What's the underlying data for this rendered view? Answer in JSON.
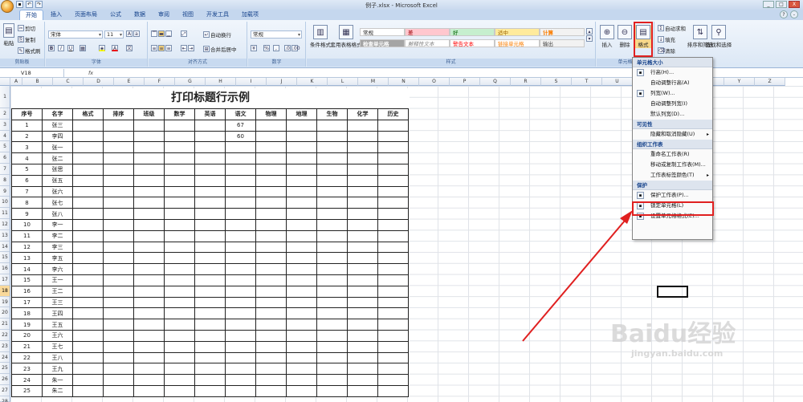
{
  "window": {
    "title": "例子.xlsx - Microsoft Excel",
    "min": "_",
    "max": "□",
    "close": "X"
  },
  "tabs": [
    "开始",
    "插入",
    "页面布局",
    "公式",
    "数据",
    "审阅",
    "视图",
    "开发工具",
    "加载项"
  ],
  "ribbon": {
    "clipboard": {
      "label": "剪贴板",
      "paste": "粘贴",
      "cut": "剪切",
      "copy": "复制",
      "format_painter": "格式刷"
    },
    "font": {
      "label": "字体",
      "name": "宋体",
      "size": "11",
      "bold": "B",
      "italic": "I",
      "underline": "U"
    },
    "align": {
      "label": "对齐方式",
      "wrap": "自动换行",
      "merge": "合并后居中"
    },
    "number": {
      "label": "数字",
      "format": "常规",
      "percent": "%",
      "comma": ","
    },
    "styles": {
      "label": "样式",
      "cond": "条件格式",
      "table": "套用表格格式",
      "cells": [
        "常规",
        "差",
        "好",
        "适中",
        "计算",
        "检查单元格",
        "解释性文本",
        "警告文本",
        "链接单元格",
        "输出"
      ]
    },
    "cells": {
      "label": "单元格",
      "insert": "插入",
      "delete": "删除",
      "format": "格式"
    },
    "editing": {
      "autosum": "自动求和",
      "fill": "填充",
      "clear": "清除",
      "sort": "排序和筛选",
      "find": "查找和选择"
    }
  },
  "formula_bar": {
    "cell_ref": "V18",
    "fx": "fx"
  },
  "columns": [
    "A",
    "B",
    "C",
    "D",
    "E",
    "F",
    "G",
    "H",
    "I",
    "J",
    "K",
    "L",
    "M",
    "N",
    "O",
    "P",
    "Q",
    "R",
    "S",
    "T",
    "U",
    "V",
    "W",
    "X",
    "Y",
    "Z"
  ],
  "sheet": {
    "title": "打印标题行示例",
    "headers": [
      "序号",
      "名字",
      "格式",
      "排序",
      "班级",
      "数学",
      "英语",
      "语文",
      "物理",
      "地理",
      "生物",
      "化学",
      "历史"
    ],
    "rows": [
      [
        "1",
        "张三",
        "",
        "",
        "",
        "",
        "",
        "67",
        "",
        "",
        "",
        "",
        ""
      ],
      [
        "2",
        "李四",
        "",
        "",
        "",
        "",
        "",
        "60",
        "",
        "",
        "",
        "",
        ""
      ],
      [
        "3",
        "张一",
        "",
        "",
        "",
        "",
        "",
        "",
        "",
        "",
        "",
        "",
        ""
      ],
      [
        "4",
        "张二",
        "",
        "",
        "",
        "",
        "",
        "",
        "",
        "",
        "",
        "",
        ""
      ],
      [
        "5",
        "张思",
        "",
        "",
        "",
        "",
        "",
        "",
        "",
        "",
        "",
        "",
        ""
      ],
      [
        "6",
        "张五",
        "",
        "",
        "",
        "",
        "",
        "",
        "",
        "",
        "",
        "",
        ""
      ],
      [
        "7",
        "张六",
        "",
        "",
        "",
        "",
        "",
        "",
        "",
        "",
        "",
        "",
        ""
      ],
      [
        "8",
        "张七",
        "",
        "",
        "",
        "",
        "",
        "",
        "",
        "",
        "",
        "",
        ""
      ],
      [
        "9",
        "张八",
        "",
        "",
        "",
        "",
        "",
        "",
        "",
        "",
        "",
        "",
        ""
      ],
      [
        "10",
        "李一",
        "",
        "",
        "",
        "",
        "",
        "",
        "",
        "",
        "",
        "",
        ""
      ],
      [
        "11",
        "李二",
        "",
        "",
        "",
        "",
        "",
        "",
        "",
        "",
        "",
        "",
        ""
      ],
      [
        "12",
        "李三",
        "",
        "",
        "",
        "",
        "",
        "",
        "",
        "",
        "",
        "",
        ""
      ],
      [
        "13",
        "李五",
        "",
        "",
        "",
        "",
        "",
        "",
        "",
        "",
        "",
        "",
        ""
      ],
      [
        "14",
        "李六",
        "",
        "",
        "",
        "",
        "",
        "",
        "",
        "",
        "",
        "",
        ""
      ],
      [
        "15",
        "王一",
        "",
        "",
        "",
        "",
        "",
        "",
        "",
        "",
        "",
        "",
        ""
      ],
      [
        "16",
        "王二",
        "",
        "",
        "",
        "",
        "",
        "",
        "",
        "",
        "",
        "",
        ""
      ],
      [
        "17",
        "王三",
        "",
        "",
        "",
        "",
        "",
        "",
        "",
        "",
        "",
        "",
        ""
      ],
      [
        "18",
        "王四",
        "",
        "",
        "",
        "",
        "",
        "",
        "",
        "",
        "",
        "",
        ""
      ],
      [
        "19",
        "王五",
        "",
        "",
        "",
        "",
        "",
        "",
        "",
        "",
        "",
        "",
        ""
      ],
      [
        "20",
        "王六",
        "",
        "",
        "",
        "",
        "",
        "",
        "",
        "",
        "",
        "",
        ""
      ],
      [
        "21",
        "王七",
        "",
        "",
        "",
        "",
        "",
        "",
        "",
        "",
        "",
        "",
        ""
      ],
      [
        "22",
        "王八",
        "",
        "",
        "",
        "",
        "",
        "",
        "",
        "",
        "",
        "",
        ""
      ],
      [
        "23",
        "王九",
        "",
        "",
        "",
        "",
        "",
        "",
        "",
        "",
        "",
        "",
        ""
      ],
      [
        "24",
        "朱一",
        "",
        "",
        "",
        "",
        "",
        "",
        "",
        "",
        "",
        "",
        ""
      ],
      [
        "25",
        "朱二",
        "",
        "",
        "",
        "",
        "",
        "",
        "",
        "",
        "",
        "",
        ""
      ]
    ]
  },
  "menu": {
    "sections": [
      {
        "title": "单元格大小",
        "items": [
          {
            "label": "行高(H)...",
            "icon": "row-height-icon"
          },
          {
            "label": "自动调整行高(A)",
            "icon": ""
          },
          {
            "label": "列宽(W)...",
            "icon": "column-width-icon"
          },
          {
            "label": "自动调整列宽(I)",
            "icon": ""
          },
          {
            "label": "默认列宽(D)...",
            "icon": ""
          }
        ]
      },
      {
        "title": "可见性",
        "items": [
          {
            "label": "隐藏和取消隐藏(U)",
            "icon": "",
            "arrow": "▸"
          }
        ]
      },
      {
        "title": "组织工作表",
        "items": [
          {
            "label": "重命名工作表(R)",
            "icon": ""
          },
          {
            "label": "移动或复制工作表(M)...",
            "icon": ""
          },
          {
            "label": "工作表标签颜色(T)",
            "icon": "",
            "arrow": "▸"
          }
        ]
      },
      {
        "title": "保护",
        "items": [
          {
            "label": "保护工作表(P)...",
            "icon": "protect-sheet-icon"
          },
          {
            "label": "锁定单元格(L)",
            "icon": "lock-icon"
          },
          {
            "label": "设置单元格格式(E)...",
            "icon": "format-cells-icon"
          }
        ]
      }
    ]
  },
  "watermark": {
    "brand": "Baidu经验",
    "url": "jingyan.baidu.com"
  },
  "colors": {
    "highlight": "#e02020",
    "ribbon": "#dbe7f5",
    "selected_row": "#f9d99b"
  }
}
